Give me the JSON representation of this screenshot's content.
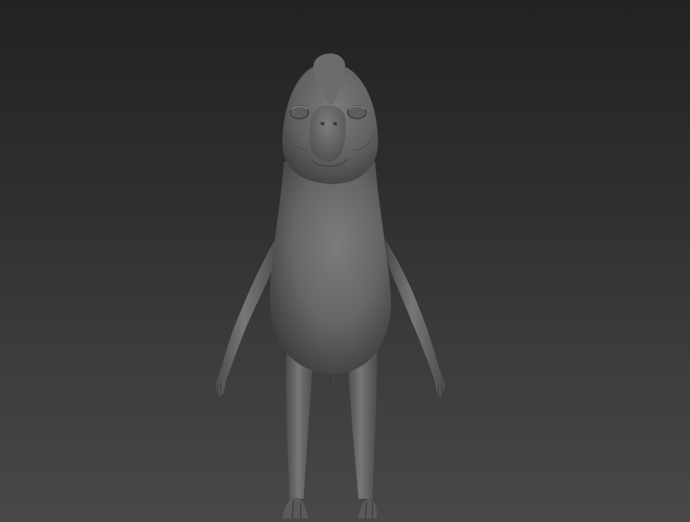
{
  "viewport": {
    "background_top": "#222222",
    "background_bottom": "#484848",
    "mesh_color": "#6f6f6f"
  },
  "model": {
    "icon": "character-sculpt-mesh"
  }
}
